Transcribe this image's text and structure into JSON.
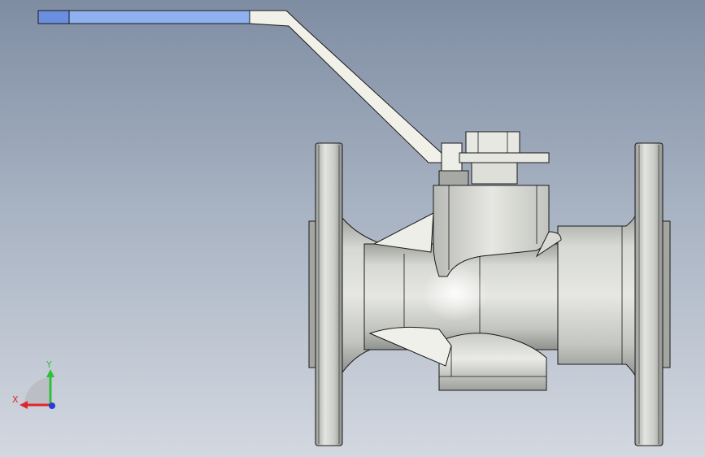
{
  "viewport": {
    "background_top": "#7f8da3",
    "background_bottom": "#d3d8e0"
  },
  "model": {
    "part": "ball-valve",
    "body_color": "#d6d8d4",
    "edge_color": "#1a1a1a",
    "handle_grip_color": "#8fb1ef",
    "handle_metal_color": "#f1f1ea"
  },
  "triad": {
    "x_label": "X",
    "y_label": "Y",
    "x_color": "#e0262c",
    "y_color": "#2fbf3a",
    "z_color": "#2a3bd6"
  }
}
